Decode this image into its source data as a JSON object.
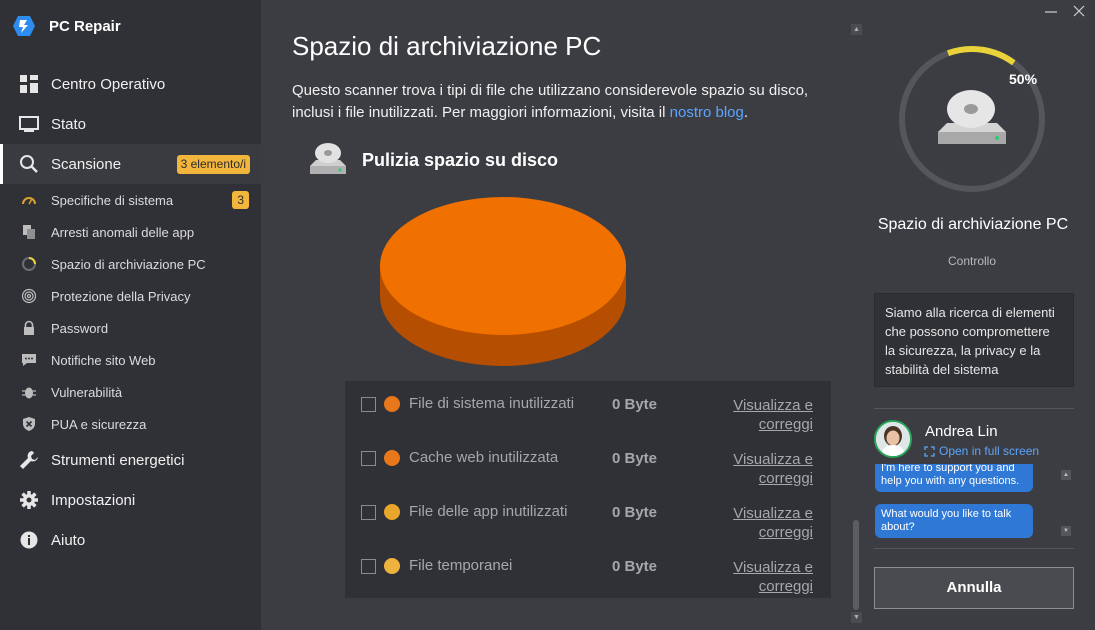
{
  "app": {
    "name": "PC Repair"
  },
  "sidebar": {
    "items": [
      {
        "label": "Centro Operativo",
        "icon": "dashboard-icon"
      },
      {
        "label": "Stato",
        "icon": "monitor-icon"
      },
      {
        "label": "Scansione",
        "icon": "search-icon",
        "badge": "3 elemento/i"
      },
      {
        "label": "Strumenti energetici",
        "icon": "wrench-icon"
      },
      {
        "label": "Impostazioni",
        "icon": "gear-icon"
      },
      {
        "label": "Aiuto",
        "icon": "info-icon"
      }
    ],
    "subitems": [
      {
        "label": "Specifiche di sistema",
        "icon": "speedometer-icon",
        "badge": "3"
      },
      {
        "label": "Arresti anomali delle app",
        "icon": "copy-icon"
      },
      {
        "label": "Spazio di archiviazione PC",
        "icon": "spinner-icon"
      },
      {
        "label": "Protezione della Privacy",
        "icon": "fingerprint-icon"
      },
      {
        "label": "Password",
        "icon": "lock-icon"
      },
      {
        "label": "Notifiche sito Web",
        "icon": "chat-icon"
      },
      {
        "label": "Vulnerabilità",
        "icon": "bug-icon"
      },
      {
        "label": "PUA e sicurezza",
        "icon": "shield-x-icon"
      }
    ]
  },
  "main": {
    "title": "Spazio di archiviazione PC",
    "desc": "Questo scanner trova i tipi di file che utilizzano considerevole spazio su disco, inclusi i file inutilizzati. Per maggiori informazioni, visita il ",
    "desc_link": "nostro blog",
    "desc_end": ".",
    "section_title": "Pulizia spazio su disco",
    "pie_color": "#f07000",
    "rows": [
      {
        "name": "File di sistema inutilizzati",
        "size": "0 Byte",
        "link": "Visualizza e correggi",
        "color": "#e8761a"
      },
      {
        "name": "Cache web inutilizzata",
        "size": "0 Byte",
        "link": "Visualizza e correggi",
        "color": "#e8761a"
      },
      {
        "name": "File delle app inutilizzati",
        "size": "0 Byte",
        "link": "Visualizza e correggi",
        "color": "#eaa62a"
      },
      {
        "name": "File temporanei",
        "size": "0 Byte",
        "link": "Visualizza e correggi",
        "color": "#edb33e"
      }
    ]
  },
  "right": {
    "progress": 0.5,
    "progress_label": "50%",
    "title": "Spazio di archiviazione PC",
    "subtitle": "Controllo",
    "info": "Siamo alla ricerca di elementi che possono compromettere la sicurezza, la privacy e la stabilità del sistema",
    "agent_name": "Andrea Lin",
    "fullscreen_label": "Open in full screen",
    "chat_messages": [
      "I'm here to support you and help you with any questions.",
      "What would you like to talk about?"
    ],
    "cancel_label": "Annulla"
  },
  "colors": {
    "accent_blue": "#5ca5ff",
    "badge": "#f2b63d",
    "gauge_arc": "#e9d23a"
  }
}
